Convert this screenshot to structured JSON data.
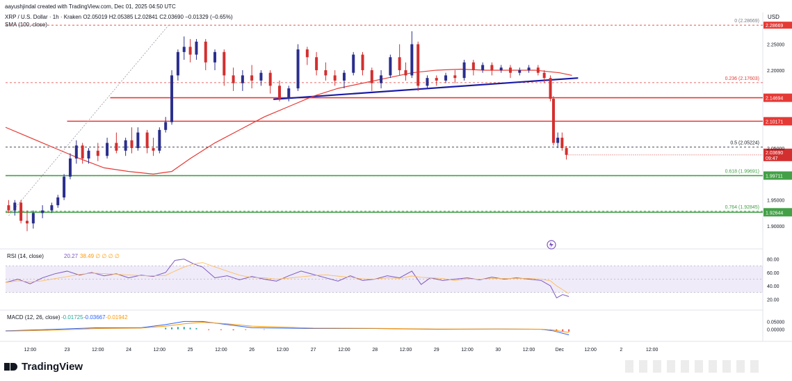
{
  "header": {
    "author_line": "aayushjindal created with TradingView.com, Dec 01, 2025 04:50 UTC",
    "symbol_line": "XRP / U.S. Dollar · 1h · Kraken  O2.05019  H2.05385  L2.02841  C2.03690  −0.01329 (−0.65%)",
    "sma_label": "SMA (100, close)",
    "currency": "USD"
  },
  "brand": {
    "name": "TradingView"
  },
  "colors": {
    "up": "#2a2e8c",
    "down": "#d32f2f",
    "sma": "#e53935",
    "trend": "#1a1aa6",
    "res": "#e53935",
    "sup": "#43a047",
    "rsi": "#7e57c2",
    "macd": "#2962ff",
    "signal": "#ff9800"
  },
  "chart_data": {
    "type": "candlestick",
    "price_axis": {
      "ylim": [
        1.88,
        2.295
      ],
      "ticks": [
        {
          "v": 2.25,
          "label": "2.25000"
        },
        {
          "v": 2.2,
          "label": "2.20000"
        },
        {
          "v": 2.05,
          "label": "2.05000"
        },
        {
          "v": 1.95,
          "label": "1.95000"
        },
        {
          "v": 1.9,
          "label": "1.90000"
        }
      ]
    },
    "time_axis": {
      "labels": [
        {
          "x": 0.4,
          "label": "12:00"
        },
        {
          "x": 1.0,
          "label": "23"
        },
        {
          "x": 1.5,
          "label": "12:00"
        },
        {
          "x": 2.0,
          "label": "24"
        },
        {
          "x": 2.5,
          "label": "12:00"
        },
        {
          "x": 3.0,
          "label": "25"
        },
        {
          "x": 3.5,
          "label": "12:00"
        },
        {
          "x": 4.0,
          "label": "26"
        },
        {
          "x": 4.5,
          "label": "12:00"
        },
        {
          "x": 5.0,
          "label": "27"
        },
        {
          "x": 5.5,
          "label": "12:00"
        },
        {
          "x": 6.0,
          "label": "28"
        },
        {
          "x": 6.5,
          "label": "12:00"
        },
        {
          "x": 7.0,
          "label": "29"
        },
        {
          "x": 7.5,
          "label": "12:00"
        },
        {
          "x": 8.0,
          "label": "30"
        },
        {
          "x": 8.5,
          "label": "12:00"
        },
        {
          "x": 9.0,
          "label": "Dec"
        },
        {
          "x": 9.5,
          "label": "12:00"
        },
        {
          "x": 10.0,
          "label": "2"
        },
        {
          "x": 10.5,
          "label": "12:00"
        }
      ],
      "xlim": [
        0,
        12.3
      ]
    },
    "fib_levels": [
      {
        "v": 2.28669,
        "label": "0 (2.28669)"
      },
      {
        "v": 2.17603,
        "label": "0.236 (2.17603)"
      },
      {
        "v": 2.05224,
        "label": "0.5 (2.05224)"
      },
      {
        "v": 1.99691,
        "label": "0.618 (1.99691)"
      },
      {
        "v": 1.92845,
        "label": "0.764 (1.92845)"
      }
    ],
    "horizontal_levels": [
      {
        "v": 2.14694,
        "label": "2.14694",
        "kind": "resistance",
        "x_start": 1.7
      },
      {
        "v": 2.10171,
        "label": "2.10171",
        "kind": "resistance",
        "x_start": 1.0
      },
      {
        "v": 1.99711,
        "label": "1.99711",
        "kind": "support",
        "x_start": 0.0
      },
      {
        "v": 1.92644,
        "label": "1.92644",
        "kind": "support",
        "x_start": 0.0
      }
    ],
    "trend_line": {
      "x1": 4.35,
      "y1": 2.144,
      "x2": 9.3,
      "y2": 2.185
    },
    "fib_anchor_line": {
      "x1": 0.05,
      "y1": 1.92,
      "x2": 2.65,
      "y2": 2.287
    },
    "current_price": {
      "value": 2.0369,
      "label": "2.03690",
      "countdown": "09:47",
      "high_badge": "2.28669"
    },
    "candles": [
      {
        "x": 0.05,
        "o": 1.94,
        "h": 1.95,
        "c": 1.93,
        "l": 1.925
      },
      {
        "x": 0.15,
        "o": 1.93,
        "h": 1.95,
        "c": 1.945,
        "l": 1.92
      },
      {
        "x": 0.25,
        "o": 1.945,
        "h": 1.95,
        "c": 1.91,
        "l": 1.905
      },
      {
        "x": 0.35,
        "o": 1.91,
        "h": 1.93,
        "c": 1.905,
        "l": 1.89
      },
      {
        "x": 0.45,
        "o": 1.905,
        "h": 1.93,
        "c": 1.925,
        "l": 1.895
      },
      {
        "x": 0.6,
        "o": 1.925,
        "h": 1.94,
        "c": 1.93,
        "l": 1.915
      },
      {
        "x": 0.75,
        "o": 1.93,
        "h": 1.945,
        "c": 1.94,
        "l": 1.925
      },
      {
        "x": 0.85,
        "o": 1.94,
        "h": 1.96,
        "c": 1.955,
        "l": 1.935
      },
      {
        "x": 0.95,
        "o": 1.955,
        "h": 2.0,
        "c": 1.995,
        "l": 1.95
      },
      {
        "x": 1.05,
        "o": 1.995,
        "h": 2.04,
        "c": 2.03,
        "l": 1.99
      },
      {
        "x": 1.15,
        "o": 2.03,
        "h": 2.065,
        "c": 2.055,
        "l": 2.02
      },
      {
        "x": 1.25,
        "o": 2.055,
        "h": 2.06,
        "c": 2.03,
        "l": 2.02
      },
      {
        "x": 1.35,
        "o": 2.03,
        "h": 2.05,
        "c": 2.045,
        "l": 2.02
      },
      {
        "x": 1.5,
        "o": 2.045,
        "h": 2.06,
        "c": 2.035,
        "l": 2.025
      },
      {
        "x": 1.65,
        "o": 2.035,
        "h": 2.07,
        "c": 2.06,
        "l": 2.03
      },
      {
        "x": 1.8,
        "o": 2.06,
        "h": 2.08,
        "c": 2.045,
        "l": 2.04
      },
      {
        "x": 1.95,
        "o": 2.045,
        "h": 2.07,
        "c": 2.065,
        "l": 2.035
      },
      {
        "x": 2.05,
        "o": 2.065,
        "h": 2.09,
        "c": 2.05,
        "l": 2.04
      },
      {
        "x": 2.15,
        "o": 2.05,
        "h": 2.09,
        "c": 2.08,
        "l": 2.045
      },
      {
        "x": 2.3,
        "o": 2.08,
        "h": 2.085,
        "c": 2.05,
        "l": 2.04
      },
      {
        "x": 2.4,
        "o": 2.05,
        "h": 2.07,
        "c": 2.045,
        "l": 2.035
      },
      {
        "x": 2.5,
        "o": 2.045,
        "h": 2.09,
        "c": 2.085,
        "l": 2.04
      },
      {
        "x": 2.6,
        "o": 2.085,
        "h": 2.11,
        "c": 2.1,
        "l": 2.08
      },
      {
        "x": 2.7,
        "o": 2.1,
        "h": 2.2,
        "c": 2.19,
        "l": 2.095
      },
      {
        "x": 2.8,
        "o": 2.19,
        "h": 2.24,
        "c": 2.235,
        "l": 2.18
      },
      {
        "x": 2.9,
        "o": 2.235,
        "h": 2.265,
        "c": 2.245,
        "l": 2.22
      },
      {
        "x": 3.0,
        "o": 2.245,
        "h": 2.26,
        "c": 2.23,
        "l": 2.215
      },
      {
        "x": 3.1,
        "o": 2.23,
        "h": 2.26,
        "c": 2.255,
        "l": 2.22
      },
      {
        "x": 3.25,
        "o": 2.255,
        "h": 2.26,
        "c": 2.215,
        "l": 2.2
      },
      {
        "x": 3.4,
        "o": 2.215,
        "h": 2.24,
        "c": 2.235,
        "l": 2.2
      },
      {
        "x": 3.55,
        "o": 2.235,
        "h": 2.24,
        "c": 2.19,
        "l": 2.17
      },
      {
        "x": 3.7,
        "o": 2.19,
        "h": 2.205,
        "c": 2.175,
        "l": 2.16
      },
      {
        "x": 3.85,
        "o": 2.175,
        "h": 2.2,
        "c": 2.19,
        "l": 2.16
      },
      {
        "x": 4.0,
        "o": 2.19,
        "h": 2.21,
        "c": 2.18,
        "l": 2.165
      },
      {
        "x": 4.15,
        "o": 2.18,
        "h": 2.2,
        "c": 2.195,
        "l": 2.17
      },
      {
        "x": 4.3,
        "o": 2.195,
        "h": 2.2,
        "c": 2.17,
        "l": 2.155
      },
      {
        "x": 4.45,
        "o": 2.17,
        "h": 2.18,
        "c": 2.145,
        "l": 2.14
      },
      {
        "x": 4.6,
        "o": 2.145,
        "h": 2.17,
        "c": 2.165,
        "l": 2.14
      },
      {
        "x": 4.75,
        "o": 2.165,
        "h": 2.25,
        "c": 2.24,
        "l": 2.16
      },
      {
        "x": 4.9,
        "o": 2.24,
        "h": 2.245,
        "c": 2.225,
        "l": 2.21
      },
      {
        "x": 5.05,
        "o": 2.225,
        "h": 2.235,
        "c": 2.2,
        "l": 2.19
      },
      {
        "x": 5.2,
        "o": 2.2,
        "h": 2.215,
        "c": 2.19,
        "l": 2.18
      },
      {
        "x": 5.35,
        "o": 2.19,
        "h": 2.2,
        "c": 2.18,
        "l": 2.17
      },
      {
        "x": 5.5,
        "o": 2.18,
        "h": 2.2,
        "c": 2.195,
        "l": 2.165
      },
      {
        "x": 5.65,
        "o": 2.195,
        "h": 2.235,
        "c": 2.23,
        "l": 2.19
      },
      {
        "x": 5.8,
        "o": 2.23,
        "h": 2.235,
        "c": 2.2,
        "l": 2.19
      },
      {
        "x": 5.95,
        "o": 2.2,
        "h": 2.205,
        "c": 2.175,
        "l": 2.16
      },
      {
        "x": 6.1,
        "o": 2.175,
        "h": 2.2,
        "c": 2.19,
        "l": 2.165
      },
      {
        "x": 6.25,
        "o": 2.19,
        "h": 2.23,
        "c": 2.225,
        "l": 2.185
      },
      {
        "x": 6.4,
        "o": 2.225,
        "h": 2.25,
        "c": 2.2,
        "l": 2.19
      },
      {
        "x": 6.5,
        "o": 2.2,
        "h": 2.215,
        "c": 2.19,
        "l": 2.18
      },
      {
        "x": 6.6,
        "o": 2.19,
        "h": 2.275,
        "c": 2.25,
        "l": 2.185
      },
      {
        "x": 6.7,
        "o": 2.25,
        "h": 2.255,
        "c": 2.17,
        "l": 2.16
      },
      {
        "x": 6.85,
        "o": 2.17,
        "h": 2.19,
        "c": 2.185,
        "l": 2.165
      },
      {
        "x": 7.0,
        "o": 2.185,
        "h": 2.19,
        "c": 2.18,
        "l": 2.17
      },
      {
        "x": 7.15,
        "o": 2.18,
        "h": 2.195,
        "c": 2.19,
        "l": 2.175
      },
      {
        "x": 7.3,
        "o": 2.19,
        "h": 2.2,
        "c": 2.185,
        "l": 2.175
      },
      {
        "x": 7.45,
        "o": 2.185,
        "h": 2.22,
        "c": 2.215,
        "l": 2.18
      },
      {
        "x": 7.6,
        "o": 2.215,
        "h": 2.22,
        "c": 2.2,
        "l": 2.19
      },
      {
        "x": 7.75,
        "o": 2.2,
        "h": 2.215,
        "c": 2.21,
        "l": 2.195
      },
      {
        "x": 7.9,
        "o": 2.21,
        "h": 2.215,
        "c": 2.2,
        "l": 2.19
      },
      {
        "x": 8.05,
        "o": 2.2,
        "h": 2.21,
        "c": 2.205,
        "l": 2.195
      },
      {
        "x": 8.2,
        "o": 2.205,
        "h": 2.21,
        "c": 2.195,
        "l": 2.185
      },
      {
        "x": 8.35,
        "o": 2.195,
        "h": 2.205,
        "c": 2.2,
        "l": 2.19
      },
      {
        "x": 8.5,
        "o": 2.2,
        "h": 2.21,
        "c": 2.205,
        "l": 2.195
      },
      {
        "x": 8.65,
        "o": 2.205,
        "h": 2.21,
        "c": 2.195,
        "l": 2.19
      },
      {
        "x": 8.75,
        "o": 2.195,
        "h": 2.2,
        "c": 2.185,
        "l": 2.175
      },
      {
        "x": 8.85,
        "o": 2.185,
        "h": 2.19,
        "c": 2.145,
        "l": 2.14
      },
      {
        "x": 8.9,
        "o": 2.145,
        "h": 2.15,
        "c": 2.06,
        "l": 2.055
      },
      {
        "x": 8.97,
        "o": 2.06,
        "h": 2.08,
        "c": 2.07,
        "l": 2.05
      },
      {
        "x": 9.04,
        "o": 2.07,
        "h": 2.08,
        "c": 2.05,
        "l": 2.045
      },
      {
        "x": 9.11,
        "o": 2.05,
        "h": 2.054,
        "c": 2.037,
        "l": 2.028
      }
    ],
    "sma100": [
      [
        0,
        2.09
      ],
      [
        0.3,
        2.075
      ],
      [
        0.6,
        2.06
      ],
      [
        0.9,
        2.045
      ],
      [
        1.2,
        2.03
      ],
      [
        1.6,
        2.012
      ],
      [
        2.0,
        2.005
      ],
      [
        2.4,
        2.0
      ],
      [
        2.7,
        2.005
      ],
      [
        3.0,
        2.03
      ],
      [
        3.4,
        2.06
      ],
      [
        3.8,
        2.085
      ],
      [
        4.2,
        2.11
      ],
      [
        4.6,
        2.13
      ],
      [
        5.0,
        2.15
      ],
      [
        5.4,
        2.165
      ],
      [
        5.8,
        2.175
      ],
      [
        6.2,
        2.185
      ],
      [
        6.6,
        2.195
      ],
      [
        7.0,
        2.2
      ],
      [
        7.4,
        2.202
      ],
      [
        7.8,
        2.2
      ],
      [
        8.2,
        2.2
      ],
      [
        8.6,
        2.2
      ],
      [
        9.0,
        2.195
      ],
      [
        9.2,
        2.19
      ]
    ],
    "rsi": {
      "label": "RSI (14, close)",
      "value_label": "20.27",
      "extra_label": "38.49  ∅ ∅ ∅ ∅",
      "ylim": [
        10,
        90
      ],
      "ticks": [
        {
          "v": 80,
          "label": "80.00"
        },
        {
          "v": 60,
          "label": "60.00"
        },
        {
          "v": 40,
          "label": "40.00"
        },
        {
          "v": 20,
          "label": "20.00"
        }
      ],
      "band": [
        30,
        70
      ],
      "values": [
        [
          0,
          45
        ],
        [
          0.2,
          50
        ],
        [
          0.4,
          43
        ],
        [
          0.6,
          52
        ],
        [
          0.8,
          58
        ],
        [
          1.0,
          62
        ],
        [
          1.2,
          56
        ],
        [
          1.4,
          60
        ],
        [
          1.6,
          55
        ],
        [
          1.8,
          58
        ],
        [
          2.0,
          52
        ],
        [
          2.2,
          56
        ],
        [
          2.4,
          54
        ],
        [
          2.6,
          60
        ],
        [
          2.75,
          78
        ],
        [
          2.9,
          80
        ],
        [
          3.05,
          73
        ],
        [
          3.2,
          68
        ],
        [
          3.4,
          52
        ],
        [
          3.6,
          55
        ],
        [
          3.8,
          49
        ],
        [
          4.0,
          54
        ],
        [
          4.2,
          50
        ],
        [
          4.4,
          47
        ],
        [
          4.6,
          55
        ],
        [
          4.8,
          62
        ],
        [
          5.0,
          57
        ],
        [
          5.2,
          52
        ],
        [
          5.4,
          47
        ],
        [
          5.6,
          55
        ],
        [
          5.8,
          48
        ],
        [
          6.0,
          50
        ],
        [
          6.2,
          55
        ],
        [
          6.4,
          52
        ],
        [
          6.6,
          62
        ],
        [
          6.75,
          42
        ],
        [
          6.9,
          52
        ],
        [
          7.1,
          48
        ],
        [
          7.3,
          50
        ],
        [
          7.5,
          52
        ],
        [
          7.7,
          49
        ],
        [
          7.9,
          53
        ],
        [
          8.1,
          50
        ],
        [
          8.3,
          52
        ],
        [
          8.5,
          50
        ],
        [
          8.7,
          48
        ],
        [
          8.85,
          40
        ],
        [
          8.95,
          22
        ],
        [
          9.05,
          27
        ],
        [
          9.15,
          24
        ]
      ]
    },
    "macd": {
      "label": "MACD (12, 26, close)",
      "values_label": [
        "-0.01725",
        "-0.03667",
        "-0.01942"
      ],
      "ylim": [
        -0.05,
        0.1
      ],
      "ticks": [
        {
          "v": 0.05,
          "label": "0.05000"
        },
        {
          "v": 0,
          "label": "0.00000"
        }
      ],
      "macd_line": [
        [
          0,
          -0.01
        ],
        [
          0.8,
          0.0
        ],
        [
          1.5,
          0.01
        ],
        [
          2.2,
          0.01
        ],
        [
          2.6,
          0.03
        ],
        [
          2.9,
          0.05
        ],
        [
          3.2,
          0.05
        ],
        [
          3.6,
          0.03
        ],
        [
          4.0,
          0.01
        ],
        [
          5.0,
          0.005
        ],
        [
          6.0,
          0.005
        ],
        [
          7.0,
          0.0
        ],
        [
          8.0,
          0.002
        ],
        [
          8.7,
          0.0
        ],
        [
          8.9,
          -0.01
        ],
        [
          9.15,
          -0.035
        ]
      ],
      "signal_line": [
        [
          0,
          -0.012
        ],
        [
          0.8,
          -0.005
        ],
        [
          1.5,
          0.005
        ],
        [
          2.2,
          0.008
        ],
        [
          2.6,
          0.02
        ],
        [
          2.9,
          0.035
        ],
        [
          3.2,
          0.045
        ],
        [
          3.6,
          0.035
        ],
        [
          4.0,
          0.02
        ],
        [
          5.0,
          0.008
        ],
        [
          6.0,
          0.006
        ],
        [
          7.0,
          0.002
        ],
        [
          8.0,
          0.002
        ],
        [
          8.7,
          0.001
        ],
        [
          8.9,
          -0.005
        ],
        [
          9.15,
          -0.02
        ]
      ],
      "histogram": [
        [
          2.6,
          0.01
        ],
        [
          2.7,
          0.012
        ],
        [
          2.8,
          0.015
        ],
        [
          2.9,
          0.015
        ],
        [
          3.0,
          0.01
        ],
        [
          3.1,
          0.008
        ],
        [
          3.3,
          -0.005
        ],
        [
          3.5,
          -0.005
        ],
        [
          3.7,
          -0.006
        ],
        [
          3.9,
          -0.004
        ],
        [
          4.2,
          -0.003
        ],
        [
          8.85,
          -0.005
        ],
        [
          8.95,
          -0.01
        ],
        [
          9.05,
          -0.014
        ],
        [
          9.15,
          -0.015
        ]
      ]
    }
  }
}
